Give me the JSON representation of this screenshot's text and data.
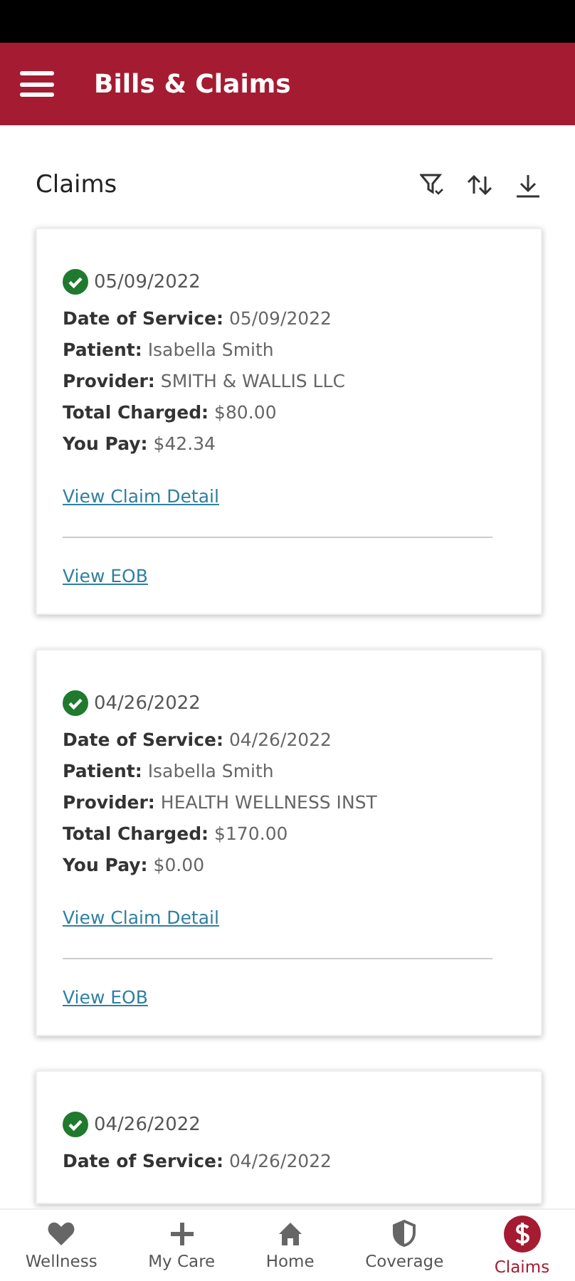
{
  "header": {
    "title": "Bills & Claims"
  },
  "section": {
    "title": "Claims"
  },
  "claims": [
    {
      "approved": true,
      "date": "05/09/2022",
      "fields": [
        {
          "label": "Date of Service:",
          "value": "05/09/2022"
        },
        {
          "label": "Patient:",
          "value": "Isabella Smith"
        },
        {
          "label": "Provider:",
          "value": "SMITH & WALLIS LLC"
        },
        {
          "label": "Total Charged:",
          "value": "$80.00"
        },
        {
          "label": "You Pay:",
          "value": "$42.34"
        }
      ],
      "detail_link": "View Claim Detail",
      "eob_link": "View EOB"
    },
    {
      "approved": true,
      "date": "04/26/2022",
      "fields": [
        {
          "label": "Date of Service:",
          "value": "04/26/2022"
        },
        {
          "label": "Patient:",
          "value": "Isabella Smith"
        },
        {
          "label": "Provider:",
          "value": "HEALTH WELLNESS INST"
        },
        {
          "label": "Total Charged:",
          "value": "$170.00"
        },
        {
          "label": "You Pay:",
          "value": "$0.00"
        }
      ],
      "detail_link": "View Claim Detail",
      "eob_link": "View EOB"
    },
    {
      "approved": true,
      "date": "04/26/2022",
      "fields": [
        {
          "label": "Date of Service:",
          "value": "04/26/2022"
        }
      ]
    }
  ],
  "nav": [
    {
      "kind": "heart",
      "label": "Wellness",
      "selected": false
    },
    {
      "kind": "plus",
      "label": "My Care",
      "selected": false
    },
    {
      "kind": "home",
      "label": "Home",
      "selected": false
    },
    {
      "kind": "shield",
      "label": "Coverage",
      "selected": false
    },
    {
      "kind": "dollar",
      "label": "Claims",
      "selected": true
    }
  ]
}
